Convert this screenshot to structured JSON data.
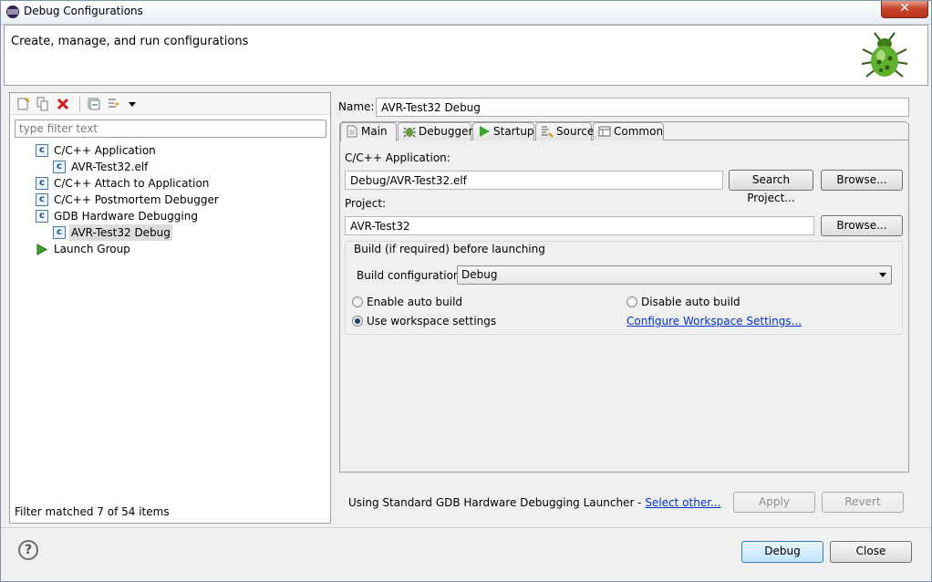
{
  "window": {
    "title": "Debug Configurations",
    "close_glyph": "✕"
  },
  "banner": {
    "title": "Create, manage, and run configurations",
    "icon": "bug-icon"
  },
  "left": {
    "toolbar_icons": [
      "new-config-icon",
      "duplicate-icon",
      "delete-icon",
      "collapse-all-icon",
      "filter-icon",
      "dropdown-arrow-icon"
    ],
    "filter_placeholder": "type filter text",
    "tree": [
      {
        "label": "C/C++ Application",
        "level": 0,
        "icon": "c-app-icon"
      },
      {
        "label": "AVR-Test32.elf",
        "level": 1,
        "icon": "c-app-icon"
      },
      {
        "label": "C/C++ Attach to Application",
        "level": 0,
        "icon": "c-app-icon"
      },
      {
        "label": "C/C++ Postmortem Debugger",
        "level": 0,
        "icon": "c-app-icon"
      },
      {
        "label": "GDB Hardware Debugging",
        "level": 0,
        "icon": "c-app-icon"
      },
      {
        "label": "AVR-Test32 Debug",
        "level": 1,
        "icon": "c-app-icon",
        "selected": true
      },
      {
        "label": "Launch Group",
        "level": 0,
        "icon": "launch-group-icon"
      }
    ],
    "status": "Filter matched 7 of 54 items"
  },
  "right": {
    "name_label": "Name:",
    "name_value": "AVR-Test32 Debug",
    "tabs": [
      {
        "label": "Main",
        "icon": "main-tab-icon"
      },
      {
        "label": "Debugger",
        "icon": "debugger-tab-icon"
      },
      {
        "label": "Startup",
        "icon": "startup-tab-icon"
      },
      {
        "label": "Source",
        "icon": "source-tab-icon"
      },
      {
        "label": "Common",
        "icon": "common-tab-icon"
      }
    ],
    "app_label": "C/C++ Application:",
    "app_value": "Debug/AVR-Test32.elf",
    "search_project_btn": "Search Project...",
    "browse_btn": "Browse...",
    "project_label": "Project:",
    "project_value": "AVR-Test32",
    "build_group_title": "Build (if required) before launching",
    "build_config_label": "Build configuration:",
    "build_config_value": "Debug",
    "radio_enable": "Enable auto build",
    "radio_disable": "Disable auto build",
    "radio_workspace": "Use workspace settings",
    "configure_link": "Configure Workspace Settings...",
    "launcher_text": "Using Standard GDB Hardware Debugging Launcher - ",
    "select_other_link": "Select other...",
    "apply_btn": "Apply",
    "revert_btn": "Revert"
  },
  "footer": {
    "help_glyph": "?",
    "debug_btn": "Debug",
    "close_btn": "Close"
  }
}
